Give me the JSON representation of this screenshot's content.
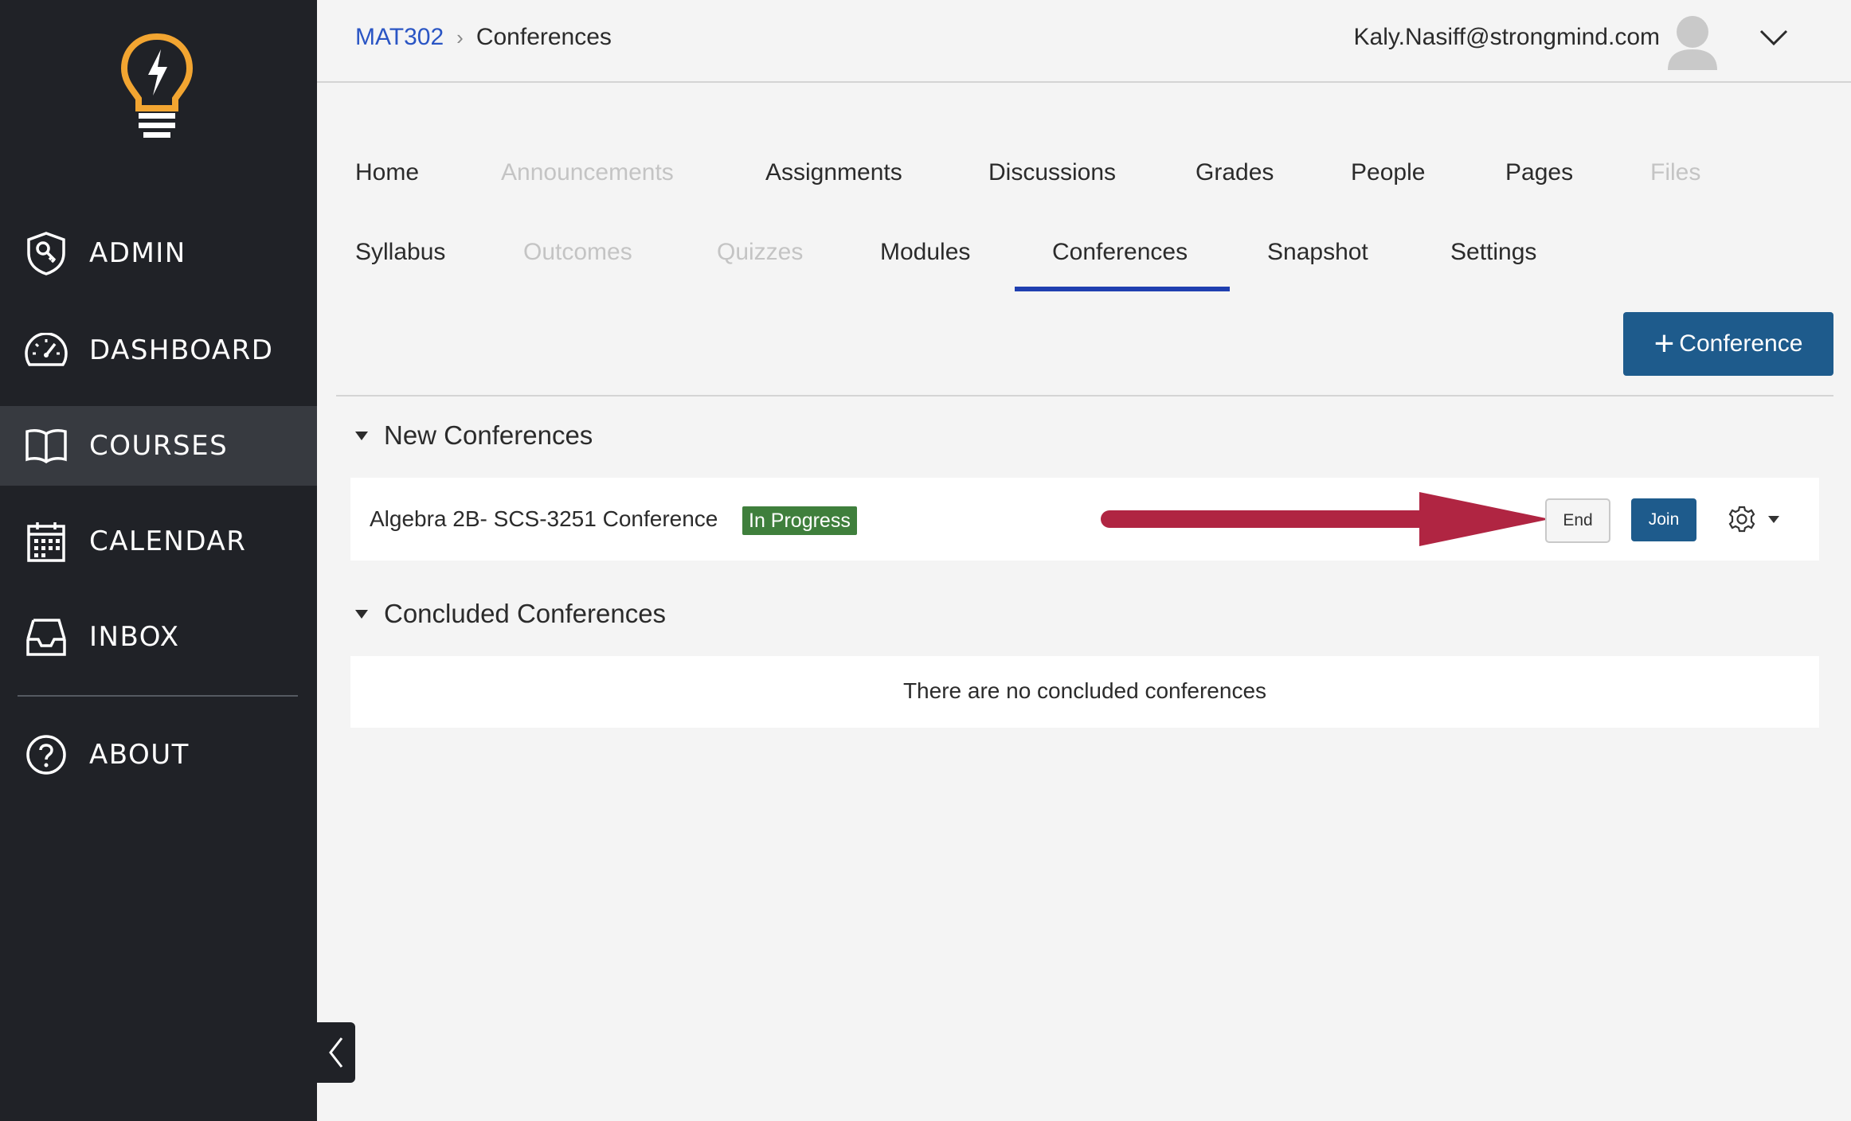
{
  "sidebar": {
    "items": [
      {
        "label": "ADMIN",
        "icon": "shield-key-icon"
      },
      {
        "label": "DASHBOARD",
        "icon": "speedometer-icon"
      },
      {
        "label": "COURSES",
        "icon": "open-book-icon",
        "active": true
      },
      {
        "label": "CALENDAR",
        "icon": "calendar-icon"
      },
      {
        "label": "INBOX",
        "icon": "inbox-tray-icon"
      },
      {
        "label": "ABOUT",
        "icon": "question-circle-icon"
      }
    ],
    "logo_icon": "lightbulb-logo-icon",
    "collapse_icon": "chevron-left-icon",
    "logo_color": "#f2a531"
  },
  "header": {
    "breadcrumb": {
      "course": "MAT302",
      "current": "Conferences"
    },
    "user_email": "Kaly.Nasiff@strongmind.com",
    "avatar_icon": "user-avatar-icon",
    "dropdown_icon": "chevron-down-icon"
  },
  "tabs": [
    {
      "label": "Home",
      "disabled": false
    },
    {
      "label": "Announcements",
      "disabled": true
    },
    {
      "label": "Assignments",
      "disabled": false
    },
    {
      "label": "Discussions",
      "disabled": false
    },
    {
      "label": "Grades",
      "disabled": false
    },
    {
      "label": "People",
      "disabled": false
    },
    {
      "label": "Pages",
      "disabled": false
    },
    {
      "label": "Files",
      "disabled": true
    },
    {
      "label": "Syllabus",
      "disabled": false
    },
    {
      "label": "Outcomes",
      "disabled": true
    },
    {
      "label": "Quizzes",
      "disabled": true
    },
    {
      "label": "Modules",
      "disabled": false
    },
    {
      "label": "Conferences",
      "disabled": false,
      "active": true
    },
    {
      "label": "Snapshot",
      "disabled": false
    },
    {
      "label": "Settings",
      "disabled": false
    }
  ],
  "add_conference": {
    "label": "Conference",
    "icon": "plus-icon"
  },
  "new_conferences": {
    "title": "New Conferences",
    "items": [
      {
        "name": "Algebra 2B- SCS-3251 Conference",
        "status": "In Progress",
        "end_label": "End",
        "join_label": "Join",
        "settings_icon": "gear-icon"
      }
    ]
  },
  "concluded_conferences": {
    "title": "Concluded Conferences",
    "empty_text": "There are no concluded conferences"
  },
  "colors": {
    "sidebar_bg": "#202227",
    "sidebar_active": "#373a40",
    "primary_button": "#1e5b8c",
    "active_tab_underline": "#1f3fb0",
    "status_badge": "#3f7f3c",
    "annotation_arrow": "#b02542",
    "link": "#2a55c4"
  }
}
